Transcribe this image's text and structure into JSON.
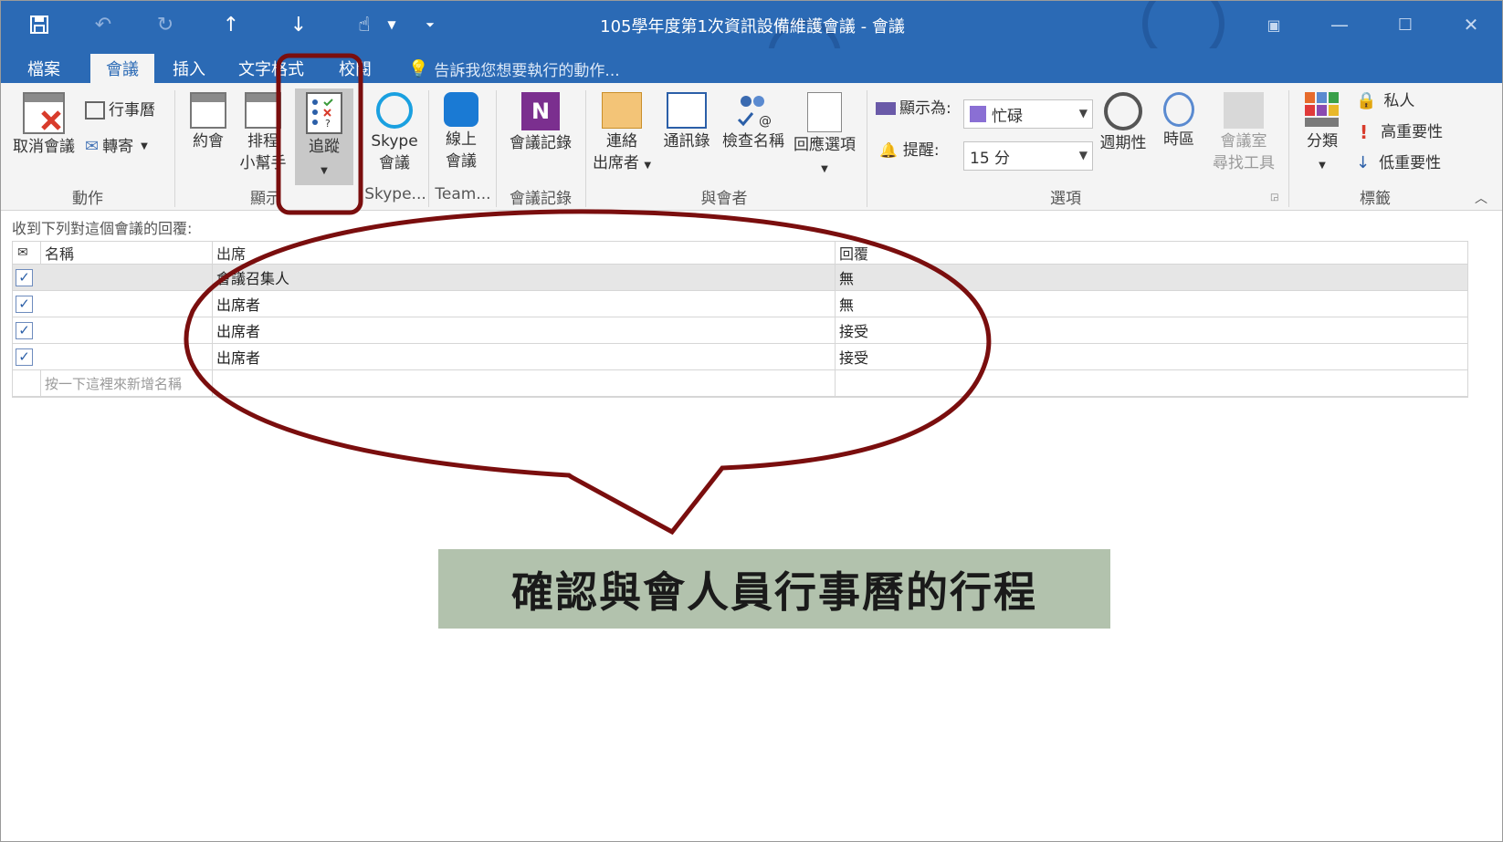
{
  "window": {
    "title": "105學年度第1次資訊設備維護會議 - 會議"
  },
  "quick_access": {
    "icons": [
      "save-icon",
      "undo-icon",
      "redo-icon",
      "up-arrow-icon",
      "down-arrow-icon",
      "touch-mode-icon",
      "customize-icon"
    ]
  },
  "tabs": [
    "檔案",
    "會議",
    "插入",
    "文字格式",
    "校閱"
  ],
  "active_tab": "會議",
  "tell_me": "告訴我您想要執行的動作...",
  "ribbon": {
    "cancel_meeting": "取消會議",
    "calendar": "行事曆",
    "forward": "轉寄",
    "appointment": "約會",
    "scheduling_1": "排程",
    "scheduling_2": "小幫手",
    "tracking": "追蹤",
    "skype_1": "Skype",
    "skype_2": "會議",
    "online_1": "線上",
    "online_2": "會議",
    "meeting_notes": "會議記錄",
    "contact_1": "連絡",
    "contact_2": "出席者",
    "address_book": "通訊錄",
    "check_names": "檢查名稱",
    "response_options": "回應選項",
    "show_as_label": "顯示為:",
    "show_as_value": "忙碌",
    "reminder_label": "提醒:",
    "reminder_value": "15 分",
    "recurrence": "週期性",
    "time_zones": "時區",
    "room_finder_1": "會議室",
    "room_finder_2": "尋找工具",
    "categorize": "分類",
    "private": "私人",
    "high_importance": "高重要性",
    "low_importance": "低重要性",
    "groups": {
      "actions": "動作",
      "show": "顯示",
      "skype": "Skype...",
      "teams": "Team...",
      "meeting_notes": "會議記錄",
      "attendees": "與會者",
      "options": "選項",
      "tags": "標籤"
    }
  },
  "tracking": {
    "caption": "收到下列對這個會議的回覆:",
    "headers": {
      "name": "名稱",
      "attendance": "出席",
      "response": "回覆"
    },
    "rows": [
      {
        "name": "",
        "attendance": "會議召集人",
        "response": "無",
        "checked": true
      },
      {
        "name": "",
        "attendance": "出席者",
        "response": "無",
        "checked": true
      },
      {
        "name": "",
        "attendance": "出席者",
        "response": "接受",
        "checked": true
      },
      {
        "name": "",
        "attendance": "出席者",
        "response": "接受",
        "checked": true
      }
    ],
    "add_placeholder": "按一下這裡來新增名稱"
  },
  "annotation": {
    "text": "確認與會人員行事曆的行程",
    "colors": {
      "outline": "#7a0e0e",
      "banner": "#b2c2ad"
    }
  }
}
